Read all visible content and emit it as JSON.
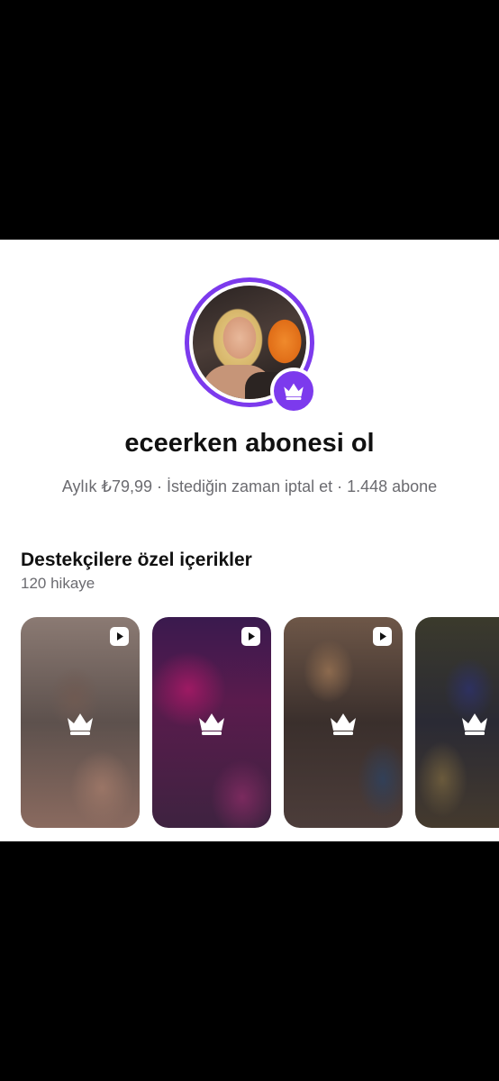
{
  "profile": {
    "title": "eceerken abonesi ol",
    "subtitle": "Aylık ₺79,99 · İstediğin zaman iptal et · 1.448 abone"
  },
  "exclusive": {
    "title": "Destekçilere özel içerikler",
    "count": "120 hikaye"
  },
  "stories": [
    {
      "type": "video",
      "locked": true
    },
    {
      "type": "video",
      "locked": true
    },
    {
      "type": "video",
      "locked": true
    },
    {
      "type": "video",
      "locked": true
    }
  ],
  "colors": {
    "accent": "#7c3aed",
    "text": "#111111",
    "muted": "#6b6b70"
  },
  "icons": {
    "badge": "crown-icon",
    "story_type": "play-icon",
    "locked": "crown-icon"
  }
}
